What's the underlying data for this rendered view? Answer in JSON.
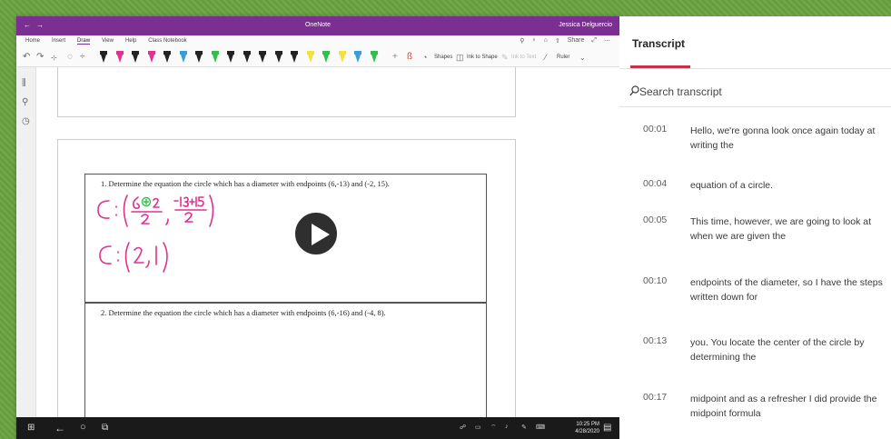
{
  "onenote": {
    "app_title": "OneNote",
    "user_name": "Jessica Delguercio",
    "menu": [
      "Home",
      "Insert",
      "Draw",
      "View",
      "Help",
      "Class Notebook"
    ],
    "menu_active": "Draw",
    "toolbar": {
      "shapes_label": "Shapes",
      "ink_to_shape_label": "Ink to Shape",
      "ink_to_text_label": "Ink to Text",
      "ruler_label": "Ruler",
      "pen_colors": [
        "#222222",
        "#e0318f",
        "#222222",
        "#e0318f",
        "#222222",
        "#3a9bdc",
        "#222222",
        "#2fbf4a",
        "#222222",
        "#222222",
        "#222222",
        "#222222",
        "#222222",
        "#f2e23a",
        "#2fbf4a",
        "#f2e23a",
        "#3a9bdc",
        "#2fbf4a"
      ]
    },
    "share_label": "Share",
    "problems": [
      {
        "text": "1.  Determine the equation the circle which has a diameter with endpoints (6,-13) and (-2, 15)."
      },
      {
        "text": "2.  Determine the equation the circle which has a diameter with endpoints (6,-16) and (-4, 8)."
      }
    ],
    "ink_color": "#e0318f",
    "taskbar": {
      "time": "10:25 PM",
      "date": "4/28/2020"
    }
  },
  "transcript": {
    "title": "Transcript",
    "search_placeholder": "Search transcript",
    "accent_color": "#c4314b",
    "entries": [
      {
        "time": "00:01",
        "text": "Hello, we're gonna look once again today at writing the"
      },
      {
        "time": "00:04",
        "text": "equation of a circle."
      },
      {
        "time": "00:05",
        "text": "This time, however, we are going to look at when we are given the"
      },
      {
        "time": "00:10",
        "text": "endpoints of the diameter, so I have the steps written down for"
      },
      {
        "time": "00:13",
        "text": "you. You locate the center of the circle by determining the"
      },
      {
        "time": "00:17",
        "text": "midpoint and as a refresher I did provide the midpoint formula"
      }
    ]
  }
}
